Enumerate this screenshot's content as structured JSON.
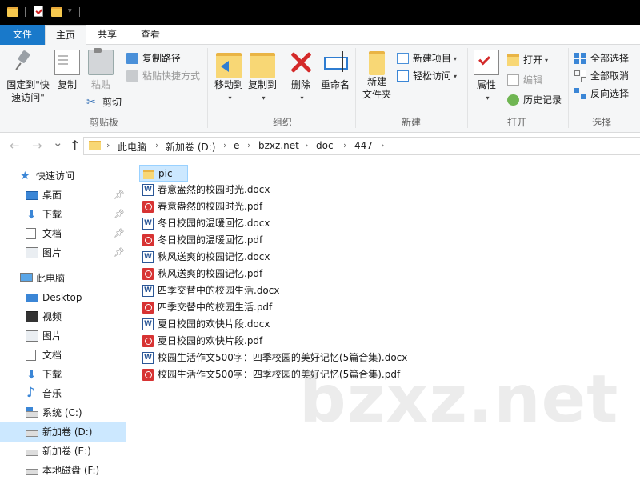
{
  "ribbon_tabs": {
    "file": "文件",
    "home": "主页",
    "share": "共享",
    "view": "查看"
  },
  "clipboard": {
    "pin_label_1": "固定到\"快",
    "pin_label_2": "速访问\"",
    "copy": "复制",
    "paste": "粘贴",
    "copy_path": "复制路径",
    "paste_shortcut": "粘贴快捷方式",
    "cut": "剪切",
    "group": "剪贴板"
  },
  "organize": {
    "move_to": "移动到",
    "copy_to": "复制到",
    "delete": "删除",
    "rename": "重命名",
    "group": "组织"
  },
  "new_group": {
    "new_folder_1": "新建",
    "new_folder_2": "文件夹",
    "new_item": "新建项目",
    "easy_access": "轻松访问",
    "group": "新建"
  },
  "open_group": {
    "properties": "属性",
    "open": "打开",
    "edit": "编辑",
    "history": "历史记录",
    "group": "打开"
  },
  "select_group": {
    "select_all": "全部选择",
    "select_none": "全部取消",
    "invert": "反向选择",
    "group": "选择"
  },
  "nav_buttons": {
    "back": "←",
    "forward": "→",
    "recent": "⌄",
    "up": "↑"
  },
  "address": [
    "此电脑",
    "新加卷 (D:)",
    "e",
    "bzxz.net",
    "doc",
    "447"
  ],
  "sidebar": {
    "quick_access": "快速访问",
    "quick_items": [
      "桌面",
      "下载",
      "文档",
      "图片"
    ],
    "this_pc": "此电脑",
    "pc_items": [
      "Desktop",
      "视频",
      "图片",
      "文档",
      "下载",
      "音乐",
      "系统 (C:)",
      "新加卷 (D:)",
      "新加卷 (E:)",
      "本地磁盘 (F:)"
    ]
  },
  "files": [
    {
      "name": "pic",
      "type": "folder"
    },
    {
      "name": "春意盎然的校园时光.docx",
      "type": "word"
    },
    {
      "name": "春意盎然的校园时光.pdf",
      "type": "pdf"
    },
    {
      "name": "冬日校园的温暖回忆.docx",
      "type": "word"
    },
    {
      "name": "冬日校园的温暖回忆.pdf",
      "type": "pdf"
    },
    {
      "name": "秋风送爽的校园记忆.docx",
      "type": "word"
    },
    {
      "name": "秋风送爽的校园记忆.pdf",
      "type": "pdf"
    },
    {
      "name": "四季交替中的校园生活.docx",
      "type": "word"
    },
    {
      "name": "四季交替中的校园生活.pdf",
      "type": "pdf"
    },
    {
      "name": "夏日校园的欢快片段.docx",
      "type": "word"
    },
    {
      "name": "夏日校园的欢快片段.pdf",
      "type": "pdf"
    },
    {
      "name": "校园生活作文500字：四季校园的美好记忆(5篇合集).docx",
      "type": "word"
    },
    {
      "name": "校园生活作文500字：四季校园的美好记忆(5篇合集).pdf",
      "type": "pdf"
    }
  ],
  "watermark": "bzxz.net"
}
